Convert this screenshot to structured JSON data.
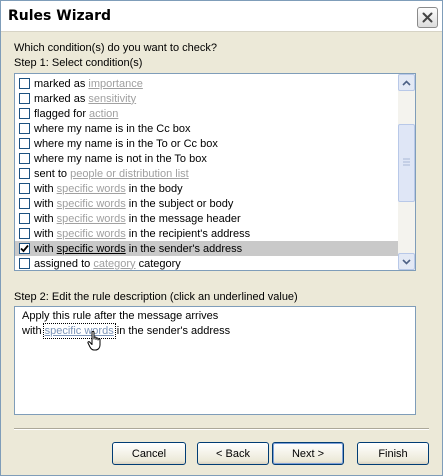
{
  "window": {
    "title": "Rules Wizard",
    "close_icon": "close-icon"
  },
  "prompt": "Which condition(s) do you want to check?",
  "step1_label": "Step 1: Select condition(s)",
  "conditions": [
    {
      "pre": "marked as ",
      "link": "importance",
      "post": "",
      "checked": false,
      "selected": false
    },
    {
      "pre": "marked as ",
      "link": "sensitivity",
      "post": "",
      "checked": false,
      "selected": false
    },
    {
      "pre": "flagged for ",
      "link": "action",
      "post": "",
      "checked": false,
      "selected": false
    },
    {
      "pre": "where my name is in the Cc box",
      "link": "",
      "post": "",
      "checked": false,
      "selected": false
    },
    {
      "pre": "where my name is in the To or Cc box",
      "link": "",
      "post": "",
      "checked": false,
      "selected": false
    },
    {
      "pre": "where my name is not in the To box",
      "link": "",
      "post": "",
      "checked": false,
      "selected": false
    },
    {
      "pre": "sent to ",
      "link": "people or distribution list",
      "post": "",
      "checked": false,
      "selected": false
    },
    {
      "pre": "with ",
      "link": "specific words",
      "post": " in the body",
      "checked": false,
      "selected": false
    },
    {
      "pre": "with ",
      "link": "specific words",
      "post": " in the subject or body",
      "checked": false,
      "selected": false
    },
    {
      "pre": "with ",
      "link": "specific words",
      "post": " in the message header",
      "checked": false,
      "selected": false
    },
    {
      "pre": "with ",
      "link": "specific words",
      "post": " in the recipient's address",
      "checked": false,
      "selected": false
    },
    {
      "pre": "with ",
      "link": "specific words",
      "post": " in the sender's address",
      "checked": true,
      "selected": true
    },
    {
      "pre": "assigned to ",
      "link": "category",
      "post": " category",
      "checked": false,
      "selected": false
    }
  ],
  "step2_label": "Step 2: Edit the rule description (click an underlined value)",
  "description": {
    "line1": "Apply this rule after the message arrives",
    "line2_pre": "with ",
    "line2_link": "specific words",
    "line2_post": " in the sender's address"
  },
  "buttons": {
    "cancel": "Cancel",
    "back": "< Back",
    "next": "Next >",
    "finish": "Finish"
  }
}
